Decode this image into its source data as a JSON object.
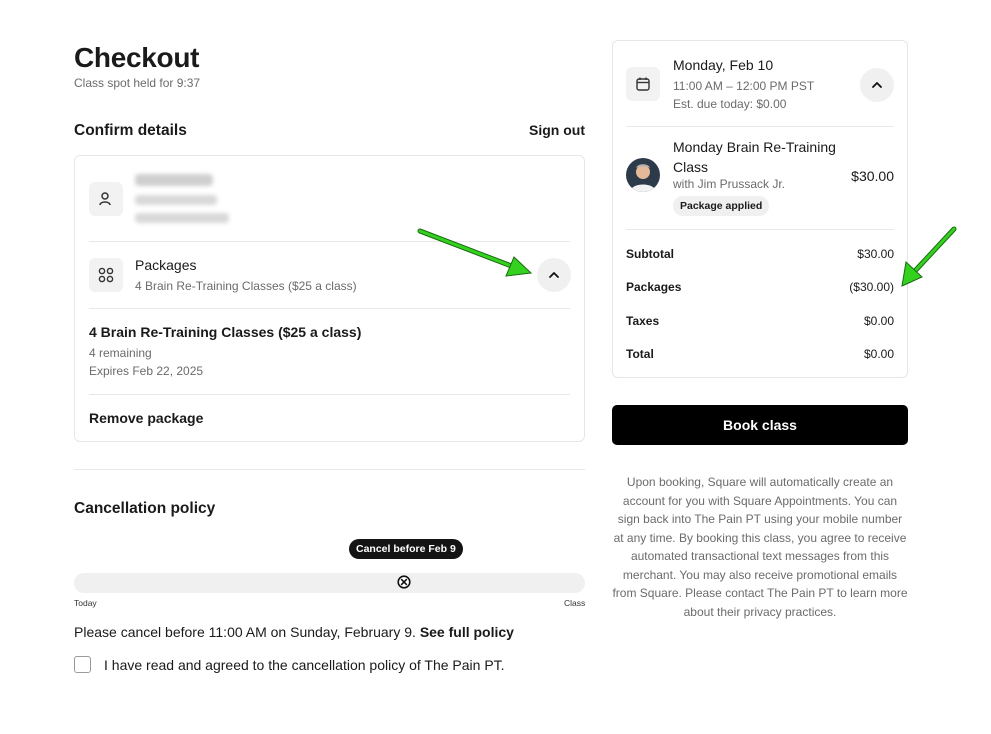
{
  "header": {
    "title": "Checkout",
    "hold_text": "Class spot held for 9:37"
  },
  "confirm": {
    "title": "Confirm details",
    "sign_out": "Sign out",
    "customer_icon": "person-icon"
  },
  "packages": {
    "icon": "grid-icon",
    "title": "Packages",
    "subtitle": "4 Brain Re-Training Classes ($25 a class)",
    "toggle_icon": "chevron-up-icon",
    "selected": {
      "name": "4 Brain Re-Training Classes ($25 a class)",
      "remaining": "4 remaining",
      "expires": "Expires Feb 22, 2025"
    },
    "remove_label": "Remove package"
  },
  "cancellation": {
    "title": "Cancellation policy",
    "badge": "Cancel before Feb 9",
    "marker_icon": "circle-x-icon",
    "track_start": "Today",
    "track_end": "Class",
    "policy_text": "Please cancel before 11:00 AM on Sunday, February 9.",
    "policy_link": "See full policy",
    "agree_label": "I have read and agreed to the cancellation policy of The Pain PT.",
    "agree_checked": false
  },
  "summary": {
    "calendar_icon": "calendar-icon",
    "date": "Monday, Feb 10",
    "time": "11:00 AM – 12:00 PM PST",
    "due": "Est. due today: $0.00",
    "collapse_icon": "chevron-up-icon",
    "class_title": "Monday Brain Re-Training Class",
    "instructor": "with Jim Prussack Jr.",
    "package_badge": "Package applied",
    "class_price": "$30.00",
    "lines": [
      {
        "label": "Subtotal",
        "value": "$30.00"
      },
      {
        "label": "Packages",
        "value": "($30.00)"
      },
      {
        "label": "Taxes",
        "value": "$0.00"
      },
      {
        "label": "Total",
        "value": "$0.00"
      }
    ]
  },
  "book_button": "Book class",
  "disclaimer": "Upon booking, Square will automatically create an account for you with Square Appointments. You can sign back into The Pain PT using your mobile number at any time. By booking this class, you agree to receive automated transactional text messages from this merchant. You may also receive promotional emails from Square. Please contact The Pain PT to learn more about their privacy practices.",
  "colors": {
    "primary": "#000000",
    "annotation_arrow": "#2ecc1a",
    "muted_text": "#6b6b6b",
    "border": "#e6e6e6"
  }
}
